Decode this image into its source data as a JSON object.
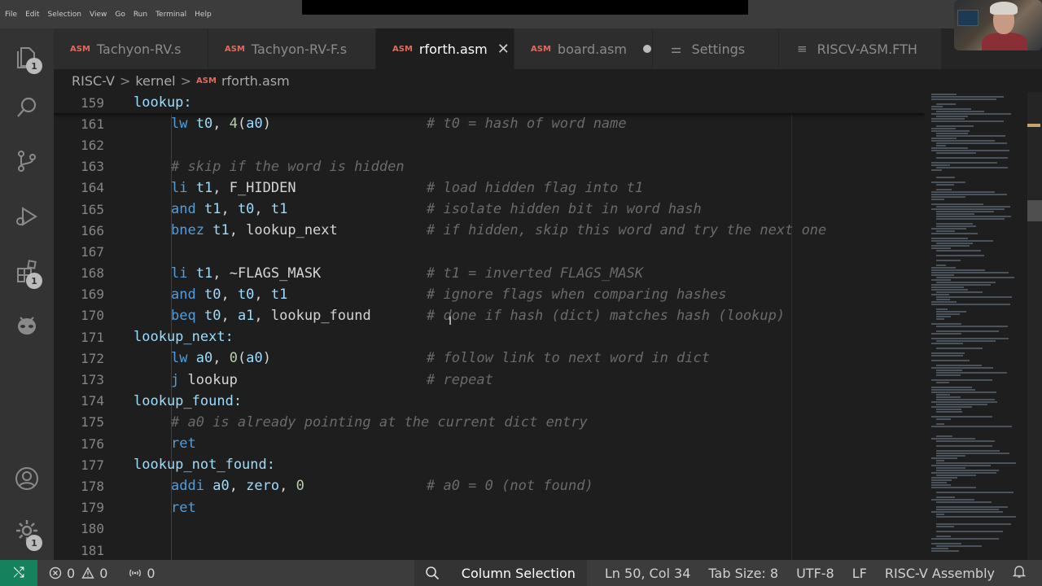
{
  "menu": [
    "File",
    "Edit",
    "Selection",
    "View",
    "Go",
    "Run",
    "Terminal",
    "Help"
  ],
  "activity_bar": {
    "explorer_badge": "1",
    "extensions_badge": "1",
    "settings_badge": "1"
  },
  "tabs": [
    {
      "type": "ASM",
      "label": "Tachyon-RV.s"
    },
    {
      "type": "ASM",
      "label": "Tachyon-RV-F.s"
    },
    {
      "type": "ASM",
      "label": "rforth.asm",
      "active": true
    },
    {
      "type": "ASM",
      "label": "board.asm",
      "modified": true
    },
    {
      "glyph": "⚌",
      "label": "Settings"
    },
    {
      "glyph": "≡",
      "label": "RISCV-ASM.FTH"
    }
  ],
  "breadcrumb": {
    "root": "RISC-V",
    "folder": "kernel",
    "file_type": "ASM",
    "file": "rforth.asm",
    "separator": ">"
  },
  "editor": {
    "lines": [
      {
        "n": "159",
        "code": "lookup:",
        "kind": "label",
        "sticky": true
      },
      {
        "n": "161",
        "code": "    lw t0, 4(a0)",
        "comment": "# t0 = hash of word name"
      },
      {
        "n": "162",
        "code": ""
      },
      {
        "n": "163",
        "code": "    # skip if the word is hidden",
        "kind": "comment"
      },
      {
        "n": "164",
        "code": "    li t1, F_HIDDEN",
        "comment": "# load hidden flag into t1"
      },
      {
        "n": "165",
        "code": "    and t1, t0, t1",
        "comment": "# isolate hidden bit in word hash"
      },
      {
        "n": "166",
        "code": "    bnez t1, lookup_next",
        "comment": "# if hidden, skip this word and try the next one"
      },
      {
        "n": "167",
        "code": ""
      },
      {
        "n": "168",
        "code": "    li t1, ~FLAGS_MASK",
        "comment": "# t1 = inverted FLAGS_MASK"
      },
      {
        "n": "169",
        "code": "    and t0, t0, t1",
        "comment": "# ignore flags when comparing hashes"
      },
      {
        "n": "170",
        "code": "    beq t0, a1, lookup_found",
        "comment": "# done if hash (dict) matches hash (lookup)"
      },
      {
        "n": "171",
        "code": "lookup_next:",
        "kind": "label"
      },
      {
        "n": "172",
        "code": "    lw a0, 0(a0)",
        "comment": "# follow link to next word in dict"
      },
      {
        "n": "173",
        "code": "    j lookup",
        "comment": "# repeat"
      },
      {
        "n": "174",
        "code": "lookup_found:",
        "kind": "label"
      },
      {
        "n": "175",
        "code": "    # a0 is already pointing at the current dict entry",
        "kind": "comment"
      },
      {
        "n": "176",
        "code": "    ret"
      },
      {
        "n": "177",
        "code": "lookup_not_found:",
        "kind": "label"
      },
      {
        "n": "178",
        "code": "    addi a0, zero, 0",
        "comment": "# a0 = 0 (not found)"
      },
      {
        "n": "179",
        "code": "    ret"
      },
      {
        "n": "180",
        "code": ""
      },
      {
        "n": "181",
        "code": ""
      }
    ]
  },
  "status": {
    "errors": "0",
    "warnings": "0",
    "ports": "0",
    "mode": "Column Selection",
    "position": "Ln 50, Col 34",
    "tab_size": "Tab Size: 8",
    "encoding": "UTF-8",
    "eol": "LF",
    "language": "RISC-V Assembly"
  },
  "colors": {
    "statusbar": "#3c3c3c",
    "remote": "#16825d",
    "editor_bg": "#1e1e1e",
    "keyword": "#569cd6",
    "register": "#9cdcfe",
    "number": "#b5cea8",
    "comment": "#6a6a6a",
    "asm_badge": "#e06c5e"
  },
  "icons": {
    "activity": [
      "files-icon",
      "search-icon",
      "source-control-icon",
      "run-debug-icon",
      "extensions-icon",
      "alien-icon",
      "account-icon",
      "settings-gear-icon"
    ],
    "status": [
      "remote-icon",
      "error-icon",
      "warning-icon",
      "ports-icon",
      "zoom-icon",
      "bell-icon"
    ]
  }
}
